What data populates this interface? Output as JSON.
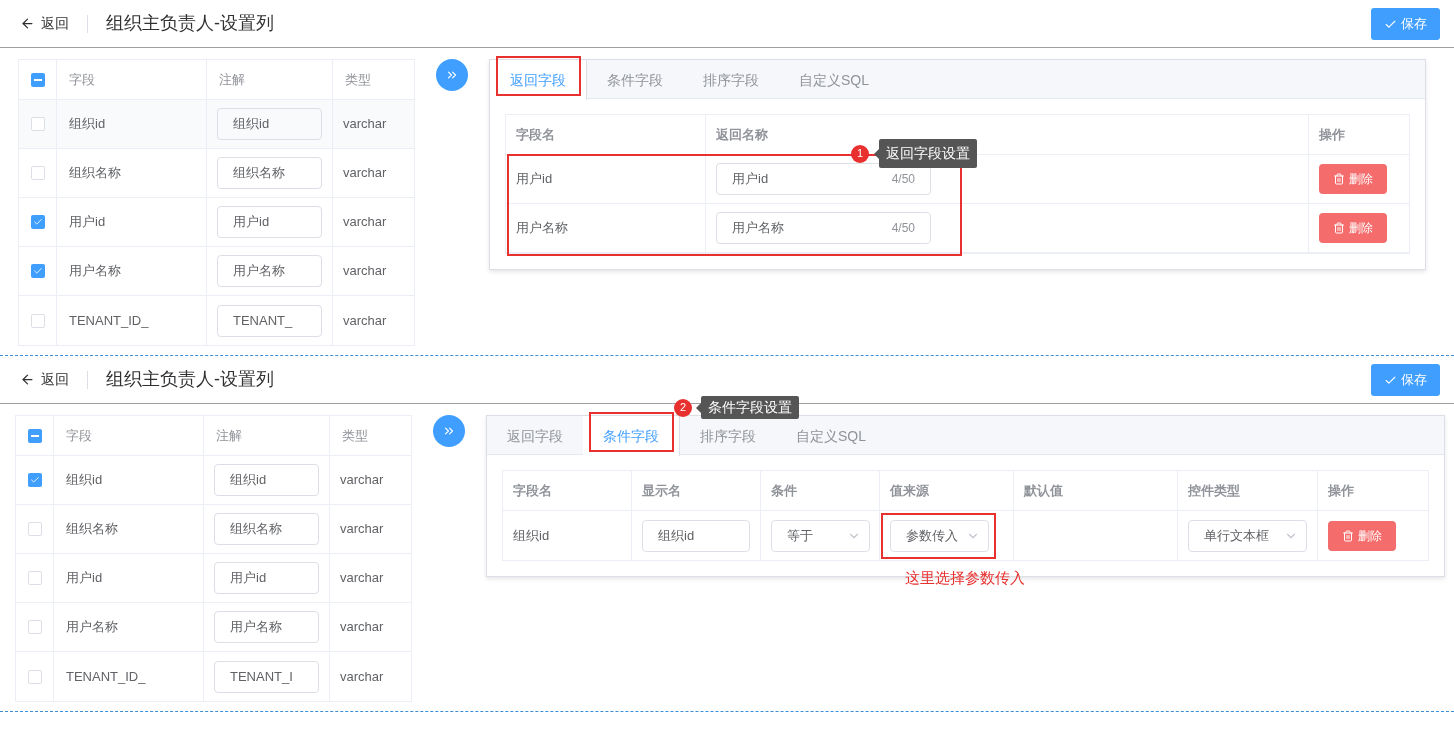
{
  "panels": [
    {
      "header": {
        "back": "返回",
        "title": "组织主负责人-设置列",
        "save": "保存"
      },
      "fields_table": {
        "header_indeterminate": true,
        "columns": [
          "字段",
          "注解",
          "类型"
        ],
        "rows": [
          {
            "checked": false,
            "field": "组织id",
            "note": "组织id",
            "type": "varchar"
          },
          {
            "checked": false,
            "field": "组织名称",
            "note": "组织名称",
            "type": "varchar"
          },
          {
            "checked": true,
            "field": "用户id",
            "note": "用户id",
            "type": "varchar"
          },
          {
            "checked": true,
            "field": "用户名称",
            "note": "用户名称",
            "type": "varchar"
          },
          {
            "checked": false,
            "field": "TENANT_ID_",
            "note": "TENANT_",
            "type": "varchar"
          }
        ]
      },
      "tabs": [
        {
          "label": "返回字段",
          "selected": true,
          "annotated": true
        },
        {
          "label": "条件字段",
          "selected": false,
          "annotated": false
        },
        {
          "label": "排序字段",
          "selected": false,
          "annotated": false
        },
        {
          "label": "自定义SQL",
          "selected": false,
          "annotated": false
        }
      ],
      "config_table": {
        "kind": "return",
        "rows_annotated": true,
        "tooltip": {
          "number": "1",
          "text": "返回字段设置"
        },
        "columns": [
          "字段名",
          "返回名称",
          "操作"
        ],
        "rows": [
          [
            {
              "kind": "text",
              "text": "用户id"
            },
            {
              "kind": "counter_input",
              "text": "用户id",
              "counter": "4/50"
            },
            {
              "kind": "delete",
              "text": "删除"
            }
          ],
          [
            {
              "kind": "text",
              "text": "用户名称"
            },
            {
              "kind": "counter_input",
              "text": "用户名称",
              "counter": "4/50"
            },
            {
              "kind": "delete",
              "text": "删除"
            }
          ]
        ]
      }
    },
    {
      "header": {
        "back": "返回",
        "title": "组织主负责人-设置列",
        "save": "保存"
      },
      "fields_table": {
        "header_indeterminate": true,
        "columns": [
          "字段",
          "注解",
          "类型"
        ],
        "rows": [
          {
            "checked": true,
            "field": "组织id",
            "note": "组织id",
            "type": "varchar"
          },
          {
            "checked": false,
            "field": "组织名称",
            "note": "组织名称",
            "type": "varchar"
          },
          {
            "checked": false,
            "field": "用户id",
            "note": "用户id",
            "type": "varchar"
          },
          {
            "checked": false,
            "field": "用户名称",
            "note": "用户名称",
            "type": "varchar"
          },
          {
            "checked": false,
            "field": "TENANT_ID_",
            "note": "TENANT_I",
            "type": "varchar"
          }
        ]
      },
      "tabs": [
        {
          "label": "返回字段",
          "selected": false,
          "annotated": false
        },
        {
          "label": "条件字段",
          "selected": true,
          "annotated": true,
          "tooltip": {
            "number": "2",
            "text": "条件字段设置"
          }
        },
        {
          "label": "排序字段",
          "selected": false,
          "annotated": false
        },
        {
          "label": "自定义SQL",
          "selected": false,
          "annotated": false
        }
      ],
      "config_table": {
        "kind": "condition",
        "columns": [
          "字段名",
          "显示名",
          "条件",
          "值来源",
          "默认值",
          "控件类型",
          "操作"
        ],
        "rows": [
          [
            {
              "kind": "text",
              "text": "组织id"
            },
            {
              "kind": "input",
              "text": "组织id"
            },
            {
              "kind": "select",
              "text": "等于"
            },
            {
              "kind": "select",
              "text": "参数传入",
              "annotated": true,
              "note": "这里选择参数传入"
            },
            {
              "kind": "empty"
            },
            {
              "kind": "select",
              "text": "单行文本框"
            },
            {
              "kind": "delete",
              "text": "删除"
            }
          ]
        ]
      }
    }
  ]
}
